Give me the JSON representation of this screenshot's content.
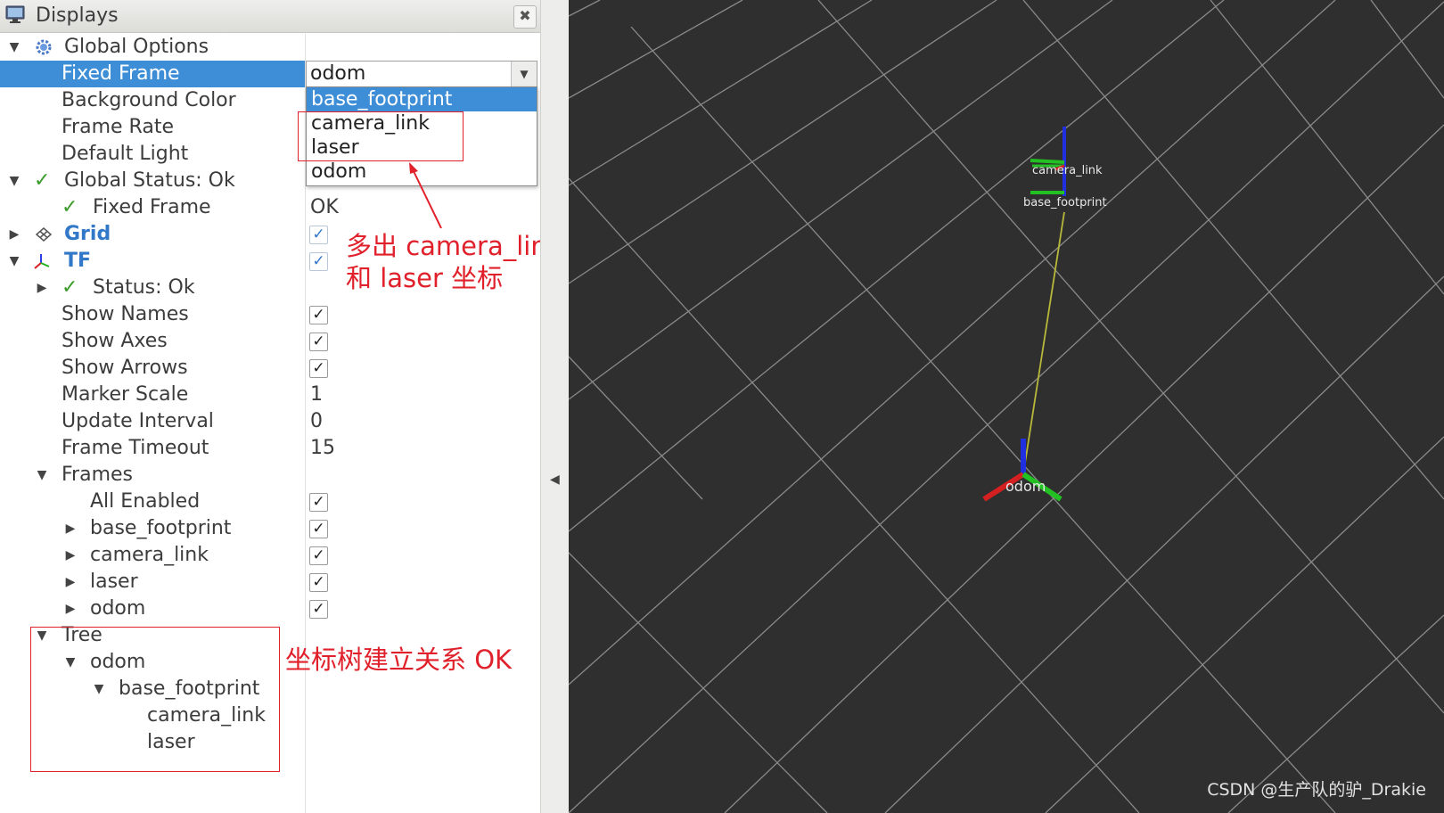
{
  "panel": {
    "title": "Displays",
    "close_glyph": "✖",
    "rows": [
      {
        "label": "Global Options"
      },
      {
        "label": "Fixed Frame"
      },
      {
        "label": "Background Color"
      },
      {
        "label": "Frame Rate"
      },
      {
        "label": "Default Light"
      },
      {
        "label": "Global Status: Ok"
      },
      {
        "label": "Fixed Frame",
        "value": "OK"
      },
      {
        "label": "Grid",
        "checked": true
      },
      {
        "label": "TF",
        "checked": true
      },
      {
        "label": "Status: Ok"
      },
      {
        "label": "Show Names",
        "checked": true
      },
      {
        "label": "Show Axes",
        "checked": true
      },
      {
        "label": "Show Arrows",
        "checked": true
      },
      {
        "label": "Marker Scale",
        "value": "1"
      },
      {
        "label": "Update Interval",
        "value": "0"
      },
      {
        "label": "Frame Timeout",
        "value": "15"
      },
      {
        "label": "Frames"
      },
      {
        "label": "All Enabled",
        "checked": true
      },
      {
        "label": "base_footprint",
        "checked": true
      },
      {
        "label": "camera_link",
        "checked": true
      },
      {
        "label": "laser",
        "checked": true
      },
      {
        "label": "odom",
        "checked": true
      },
      {
        "label": "Tree"
      },
      {
        "label": "odom"
      },
      {
        "label": "base_footprint"
      },
      {
        "label": "camera_link"
      },
      {
        "label": "laser"
      }
    ]
  },
  "fixed_frame_combo": {
    "value": "odom",
    "options": [
      "base_footprint",
      "camera_link",
      "laser",
      "odom"
    ],
    "highlighted": "base_footprint"
  },
  "annotations": {
    "new_frames_line1": "多出 camera_link",
    "new_frames_line2": "和 laser 坐标",
    "tree_ok": "坐标树建立关系 OK"
  },
  "view": {
    "frame_labels": {
      "camera_link": "camera_link",
      "base_footprint": "base_footprint",
      "odom": "odom"
    },
    "watermark": "CSDN @生产队的驴_Drakie",
    "colors": {
      "background": "#2f2f2f",
      "grid": "#8a8a8a",
      "x_axis": "#d42020",
      "y_axis": "#22c022",
      "z_axis": "#2030e0",
      "tf_line": "#b8b83a"
    }
  }
}
